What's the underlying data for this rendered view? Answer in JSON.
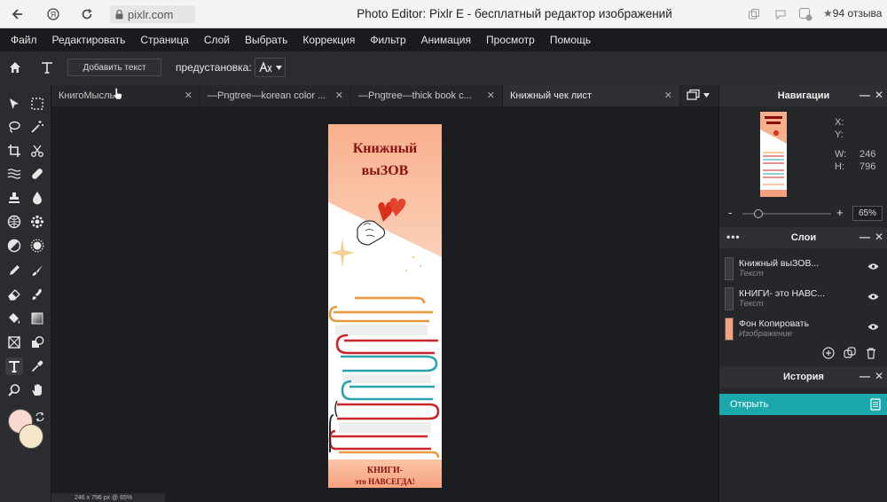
{
  "browser": {
    "url": "pixlr.com",
    "page_title": "Photo Editor: Pixlr E - бесплатный редактор изображений",
    "reviews": "94 отзыва"
  },
  "menu": [
    "Файл",
    "Редактировать",
    "Страница",
    "Слой",
    "Выбрать",
    "Коррекция",
    "Фильтр",
    "Анимация",
    "Просмотр",
    "Помощь"
  ],
  "options": {
    "add_text_label": "Добавить текст",
    "preset_label": "предустановка:"
  },
  "tabs": [
    {
      "label": "КнигоМысль"
    },
    {
      "label": "—Pngtree—korean color ..."
    },
    {
      "label": "—Pngtree—thick book c..."
    },
    {
      "label": "Книжный чек лист"
    }
  ],
  "canvas": {
    "title_line1": "Книжный",
    "title_line2": "выЗОВ",
    "bottom_line1": "КНИГИ-",
    "bottom_line2": "это НАВСЕГДА!"
  },
  "status": "246 x 796 px @ 65%",
  "navigator": {
    "title": "Навигации",
    "x_label": "X:",
    "y_label": "Y:",
    "w_label": "W:",
    "w_value": "246",
    "h_label": "H:",
    "h_value": "796",
    "zoom": "65%",
    "zoom_level": 0.18
  },
  "layers": {
    "title": "Слои",
    "items": [
      {
        "name": "Книжный выЗОВ...",
        "type": "Текст"
      },
      {
        "name": "КНИГИ- это НАВС...",
        "type": "Текст"
      },
      {
        "name": "Фон Копировать",
        "type": "Изображение"
      }
    ]
  },
  "history": {
    "title": "История",
    "items": [
      "Открыть"
    ]
  },
  "colors": {
    "accent": "#1aa8ac",
    "primary_color": "#f7d9cf",
    "secondary_color": "#f6e6c8"
  }
}
